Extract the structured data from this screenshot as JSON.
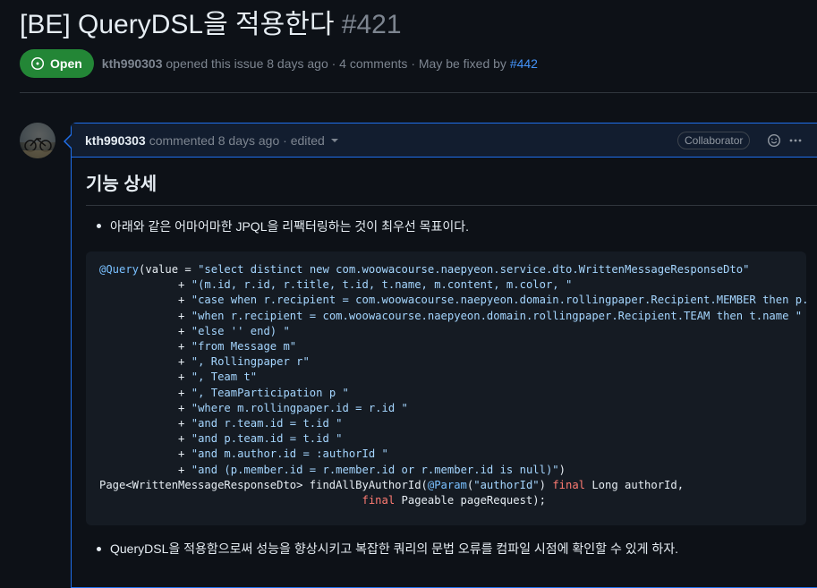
{
  "issue": {
    "title": "[BE] QueryDSL을 적용한다",
    "number": "#421",
    "state": "Open",
    "author": "kth990303",
    "meta_middle": "opened this issue 8 days ago · 4 comments · May be fixed by",
    "fix_pr": "#442"
  },
  "comment": {
    "author": "kth990303",
    "meta": "commented 8 days ago · edited",
    "role_badge": "Collaborator",
    "icons": [
      "smiley-icon",
      "kebab-menu-icon",
      "caret-down-icon",
      "issue-opened-icon"
    ],
    "heading": "기능 상세",
    "bullet_1": "아래와 같은 어마어마한 JPQL을 리팩터링하는 것이 최우선 목표이다.",
    "bullet_2": "QueryDSL을 적용함으로써 성능을 향상시키고 복잡한 쿼리의 문법 오류를 컴파일 시점에 확인할 수 있게 하자."
  },
  "code": {
    "lines": [
      [
        [
          "a",
          "@Query"
        ],
        [
          "p",
          "(value = "
        ],
        [
          "s",
          "\"select distinct new com.woowacourse.naepyeon.service.dto.WrittenMessageResponseDto\""
        ]
      ],
      [
        [
          "p",
          "            + "
        ],
        [
          "s",
          "\"(m.id, r.id, r.title, t.id, t.name, m.content, m.color, \""
        ]
      ],
      [
        [
          "p",
          "            + "
        ],
        [
          "s",
          "\"case when r.recipient = com.woowacourse.naepyeon.domain.rollingpaper.Recipient.MEMBER then p.nickname \""
        ]
      ],
      [
        [
          "p",
          "            + "
        ],
        [
          "s",
          "\"when r.recipient = com.woowacourse.naepyeon.domain.rollingpaper.Recipient.TEAM then t.name \""
        ]
      ],
      [
        [
          "p",
          "            + "
        ],
        [
          "s",
          "\"else '' end) \""
        ]
      ],
      [
        [
          "p",
          "            + "
        ],
        [
          "s",
          "\"from Message m\""
        ]
      ],
      [
        [
          "p",
          "            + "
        ],
        [
          "s",
          "\", Rollingpaper r\""
        ]
      ],
      [
        [
          "p",
          "            + "
        ],
        [
          "s",
          "\", Team t\""
        ]
      ],
      [
        [
          "p",
          "            + "
        ],
        [
          "s",
          "\", TeamParticipation p \""
        ]
      ],
      [
        [
          "p",
          "            + "
        ],
        [
          "s",
          "\"where m.rollingpaper.id = r.id \""
        ]
      ],
      [
        [
          "p",
          "            + "
        ],
        [
          "s",
          "\"and r.team.id = t.id \""
        ]
      ],
      [
        [
          "p",
          "            + "
        ],
        [
          "s",
          "\"and p.team.id = t.id \""
        ]
      ],
      [
        [
          "p",
          "            + "
        ],
        [
          "s",
          "\"and m.author.id = :authorId \""
        ]
      ],
      [
        [
          "p",
          "            + "
        ],
        [
          "s",
          "\"and (p.member.id = r.member.id or r.member.id is null)\""
        ],
        [
          "p",
          ")"
        ]
      ],
      [
        [
          "p",
          "Page<WrittenMessageResponseDto> findAllByAuthorId("
        ],
        [
          "a",
          "@Param"
        ],
        [
          "p",
          "("
        ],
        [
          "s",
          "\"authorId\""
        ],
        [
          "p",
          ") "
        ],
        [
          "k",
          "final"
        ],
        [
          "p",
          " Long authorId,"
        ]
      ],
      [
        [
          "p",
          "                                        "
        ],
        [
          "k",
          "final"
        ],
        [
          "p",
          " Pageable pageRequest);"
        ]
      ]
    ]
  },
  "colors": {
    "background": "#0d1117",
    "open_badge": "#238636",
    "link": "#4493f8",
    "comment_border": "#1f6feb",
    "comment_header_bg": "#121d2f",
    "code_bg": "#151b23"
  }
}
